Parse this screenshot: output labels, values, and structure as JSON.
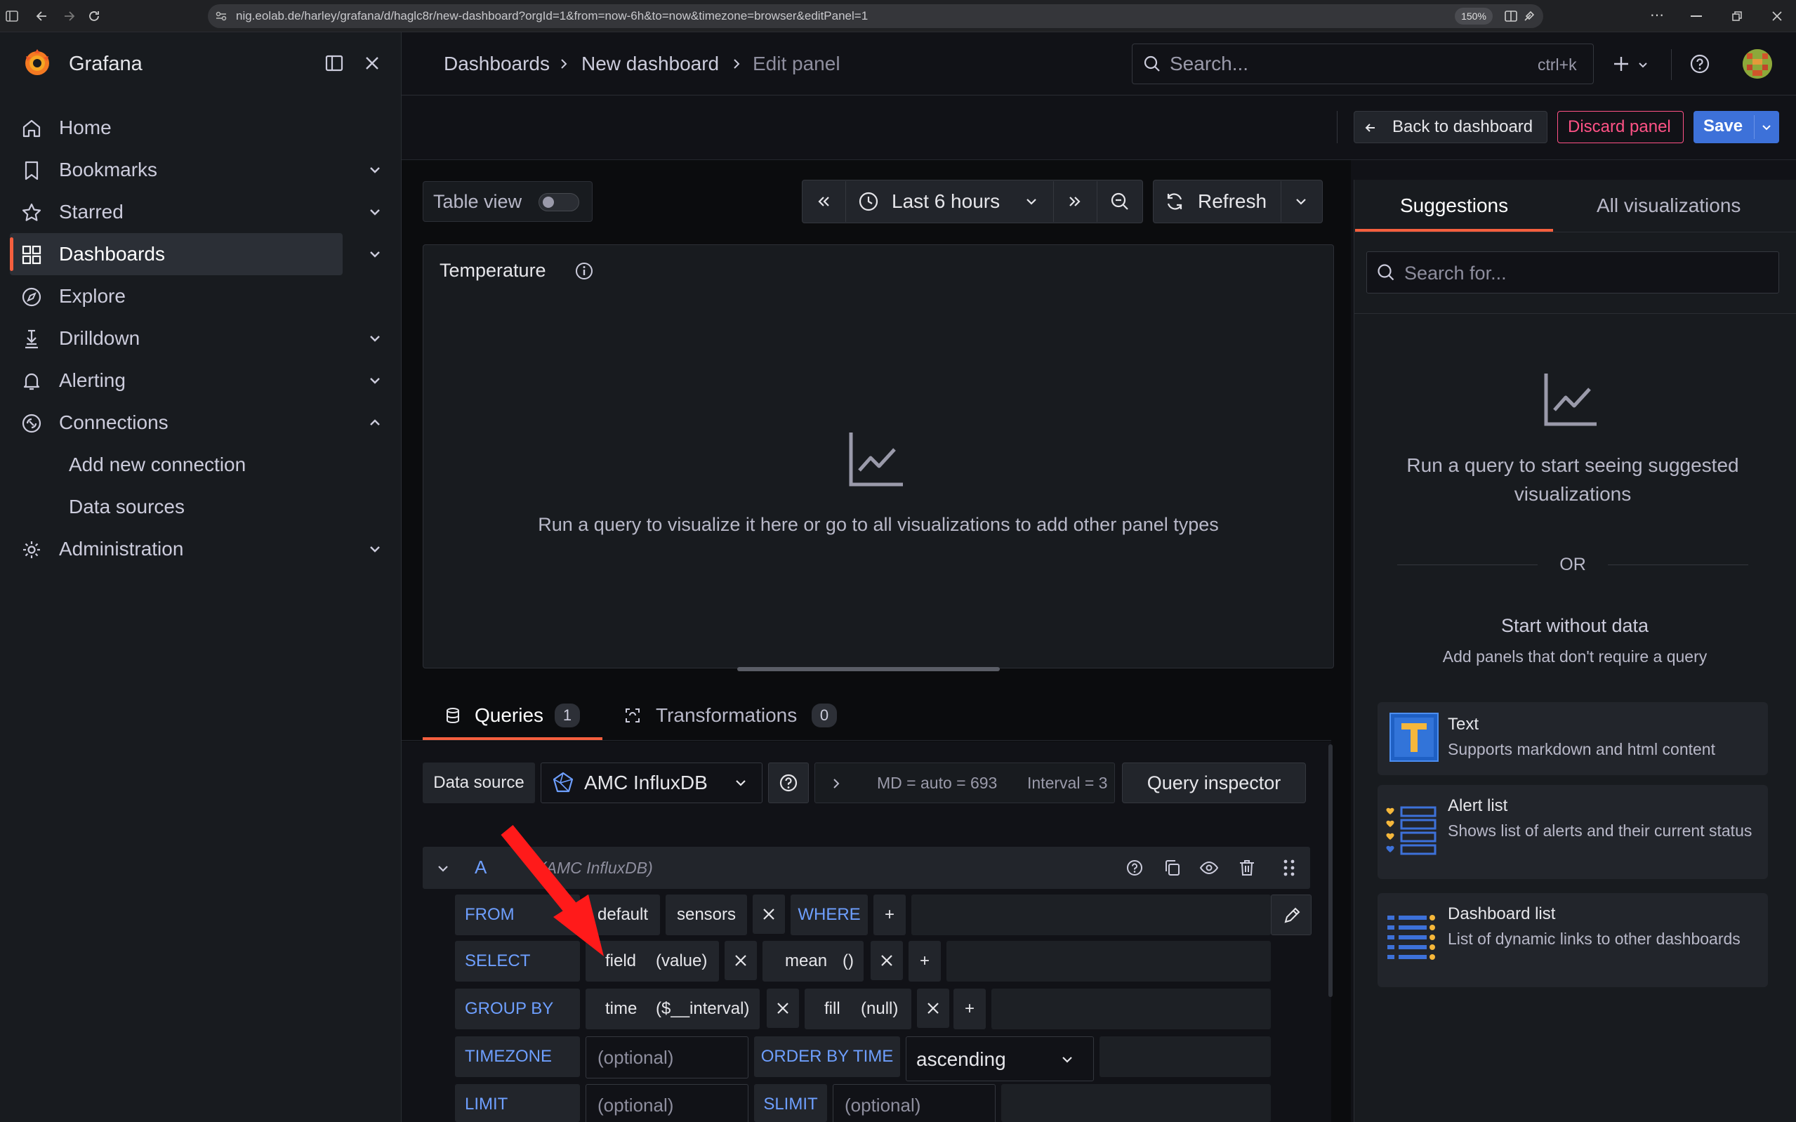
{
  "browser": {
    "url": "nig.eolab.de/harley/grafana/d/haglc8r/new-dashboard?orgId=1&from=now-6h&to=now&timezone=browser&editPanel=1",
    "zoom": "150%"
  },
  "app": {
    "name": "Grafana"
  },
  "sidebar": {
    "items": [
      {
        "label": "Home"
      },
      {
        "label": "Bookmarks"
      },
      {
        "label": "Starred"
      },
      {
        "label": "Dashboards"
      },
      {
        "label": "Explore"
      },
      {
        "label": "Drilldown"
      },
      {
        "label": "Alerting"
      },
      {
        "label": "Connections"
      },
      {
        "label": "Add new connection"
      },
      {
        "label": "Data sources"
      },
      {
        "label": "Administration"
      }
    ]
  },
  "breadcrumb": {
    "c1": "Dashboards",
    "c2": "New dashboard",
    "c3": "Edit panel"
  },
  "search": {
    "placeholder": "Search...",
    "shortcut": "ctrl+k"
  },
  "actions": {
    "back": "Back to dashboard",
    "discard": "Discard panel",
    "save": "Save"
  },
  "controls": {
    "table_view": "Table view",
    "time_range": "Last 6 hours",
    "refresh": "Refresh"
  },
  "panel": {
    "title": "Temperature",
    "empty_message": "Run a query to visualize it here or go to all visualizations to add other panel types"
  },
  "query_tabs": {
    "queries": "Queries",
    "queries_count": "1",
    "transformations": "Transformations",
    "transformations_count": "0"
  },
  "datasource": {
    "label": "Data source",
    "name": "AMC InfluxDB",
    "options": "MD = auto = 693",
    "interval": "Interval = 3",
    "inspector": "Query inspector"
  },
  "query": {
    "ref": "A",
    "ds_hint": "(AMC InfluxDB)",
    "from_kw": "FROM",
    "from_policy": "default",
    "from_measurement": "sensors",
    "where_kw": "WHERE",
    "plus": "+",
    "select_kw": "SELECT",
    "select_field": "field",
    "select_field_arg": "(value)",
    "select_fn": "mean",
    "select_fn_arg": "()",
    "groupby_kw": "GROUP BY",
    "group_time": "time",
    "group_time_arg": "($__interval)",
    "group_fill": "fill",
    "group_fill_arg": "(null)",
    "timezone_kw": "TIMEZONE",
    "timezone_placeholder": "(optional)",
    "orderby_kw": "ORDER BY TIME",
    "orderby_value": "ascending",
    "limit_kw": "LIMIT",
    "limit_placeholder": "(optional)",
    "slimit_kw": "SLIMIT",
    "slimit_placeholder": "(optional)"
  },
  "viz_pane": {
    "tab_suggestions": "Suggestions",
    "tab_all": "All visualizations",
    "search_placeholder": "Search for...",
    "empty_message": "Run a query to start seeing suggested visualizations",
    "or": "OR",
    "start_without": "Start without data",
    "start_without_sub": "Add panels that don't require a query",
    "cards": [
      {
        "title": "Text",
        "desc": "Supports markdown and html content"
      },
      {
        "title": "Alert list",
        "desc": "Shows list of alerts and their current status"
      },
      {
        "title": "Dashboard list",
        "desc": "List of dynamic links to other dashboards"
      }
    ]
  },
  "colors": {
    "accent": "#f55f3e",
    "primary": "#3d71d9",
    "discard": "#ff5286",
    "keyword": "#6e9fff",
    "annotation": "#ff1a1a"
  }
}
